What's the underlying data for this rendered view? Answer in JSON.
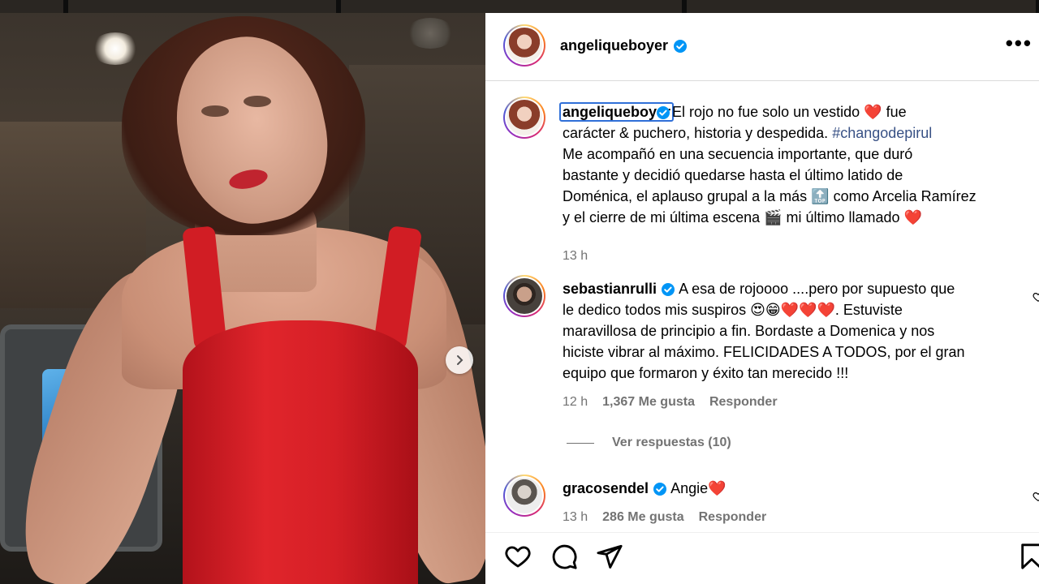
{
  "post": {
    "author": "angeliqueboyer",
    "more_label": "•••",
    "caption": {
      "username": "angeliqueboyer",
      "line1": "El rojo no fue solo un vestido ❤️ fue",
      "line2a": "carácter & puchero, historia y despedida. ",
      "hashtag": "#changodepirul",
      "line3": "Me acompañó en una secuencia importante, que duró",
      "line4": "bastante y decidió quedarse hasta el último latido de",
      "line5": "Doménica, el aplauso grupal a la más 🔝 como Arcelia Ramírez",
      "line6": "y el cierre de mi última escena 🎬 mi último llamado ❤️",
      "time": "13 h"
    }
  },
  "comments": [
    {
      "username": "sebastianrulli",
      "lines": [
        "A esa de rojoooo ....pero por supuesto que",
        "le dedico todos mis suspiros 😍😁❤️❤️❤️. Estuviste",
        "maravillosa de principio a fin. Bordaste a Domenica y nos",
        "hiciste vibrar al máximo. FELICIDADES A TODOS, por el gran",
        "equipo que formaron y éxito tan merecido !!!"
      ],
      "time": "12 h",
      "likes": "1,367 Me gusta",
      "reply": "Responder",
      "view_replies": "Ver respuestas (10)"
    },
    {
      "username": "gracosendel",
      "text": "Angie❤️",
      "time": "13 h",
      "likes": "286 Me gusta",
      "reply": "Responder"
    }
  ],
  "icons": [
    "heart-icon",
    "comment-icon",
    "share-icon",
    "bookmark-icon",
    "verified-icon",
    "chevron-right-icon",
    "more-icon"
  ]
}
